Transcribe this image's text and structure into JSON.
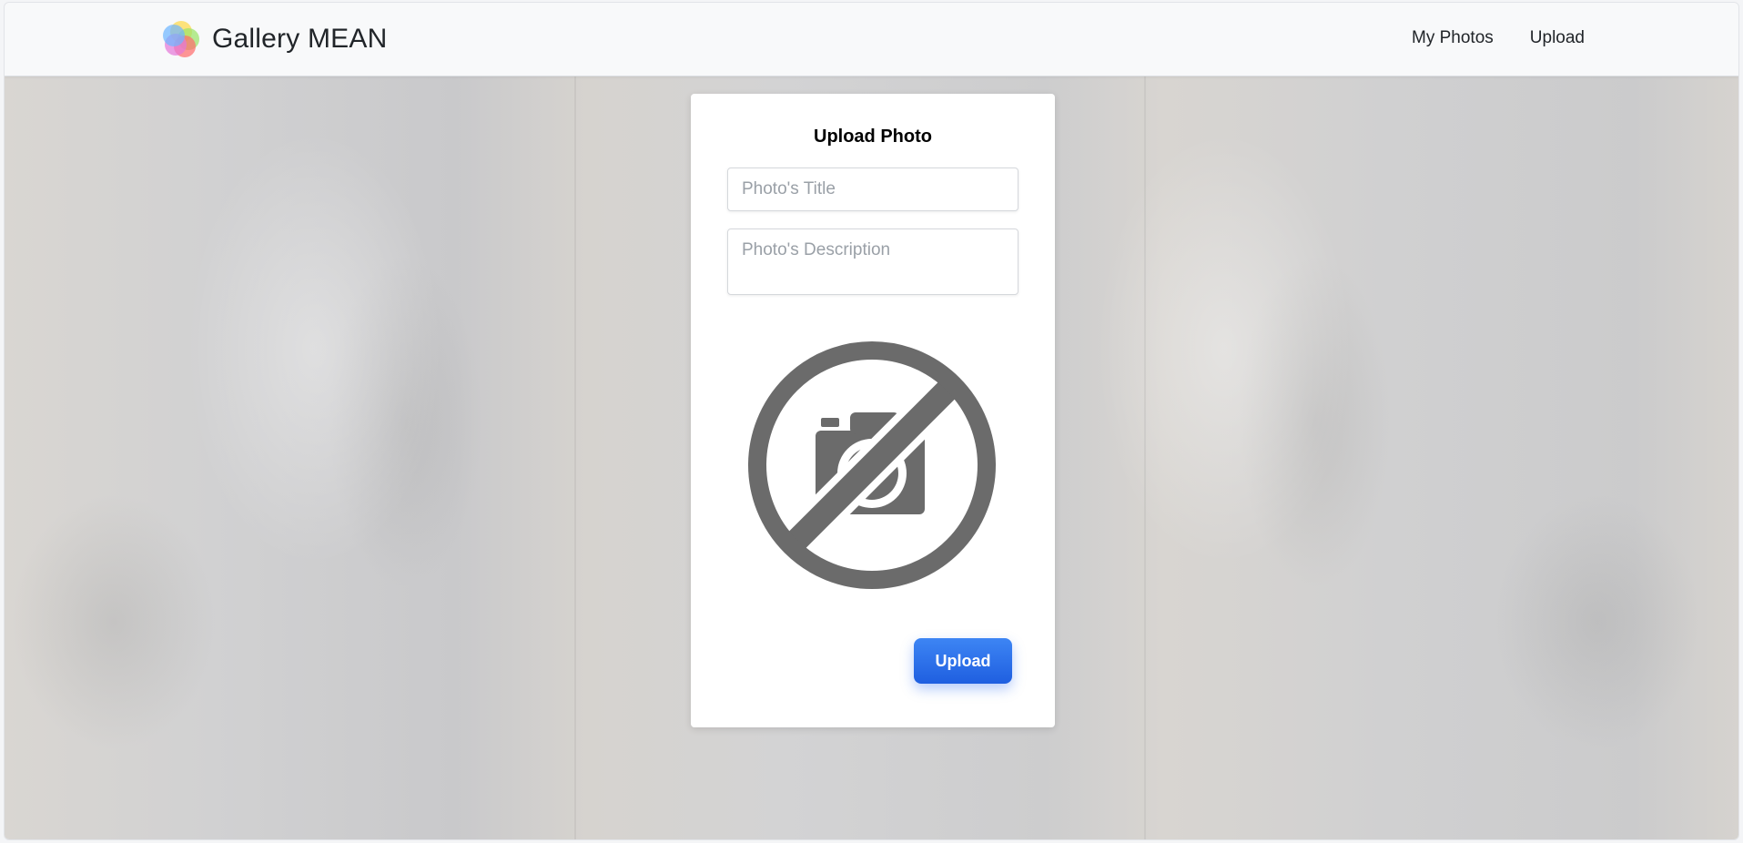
{
  "navbar": {
    "brand": "Gallery MEAN",
    "links": [
      "My Photos",
      "Upload"
    ]
  },
  "upload_form": {
    "title": "Upload Photo",
    "title_placeholder": "Photo's Title",
    "description_placeholder": "Photo's Description",
    "submit_label": "Upload",
    "preview_icon": "no-camera-icon"
  },
  "colors": {
    "accent": "#2f72ee",
    "icon_gray": "#6b6b6b",
    "navbar_bg": "#f8f9fa"
  }
}
